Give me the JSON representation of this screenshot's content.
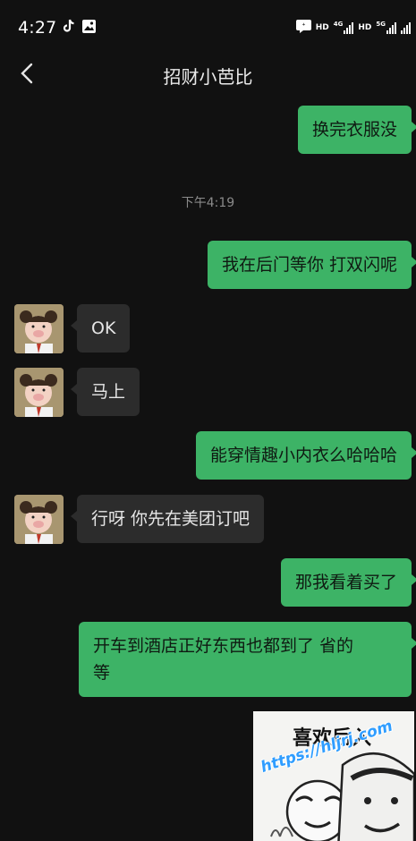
{
  "status_bar": {
    "time": "4:27",
    "left_icons": [
      "tiktok-icon",
      "gallery-icon"
    ],
    "right_icons": [
      "message-badge-icon",
      "hd-label",
      "4g-signal-icon",
      "hd-label",
      "5g-signal-icon",
      "signal-icon"
    ],
    "hd1": "HD",
    "net1": "4G",
    "hd2": "HD",
    "net2": "5G"
  },
  "header": {
    "title": "招财小芭比"
  },
  "messages": [
    {
      "side": "me",
      "text": "换完衣服没"
    },
    {
      "type": "timestamp",
      "text": "下午4:19"
    },
    {
      "side": "me",
      "text": "我在后门等你 打双闪呢"
    },
    {
      "side": "them",
      "text": "OK"
    },
    {
      "side": "them",
      "text": "马上"
    },
    {
      "side": "me",
      "text": "能穿情趣小内衣么哈哈哈"
    },
    {
      "side": "them",
      "text": "行呀 你先在美团订吧"
    },
    {
      "side": "me",
      "text": "那我看着买了"
    },
    {
      "side": "me",
      "line1": "开车到酒店正好东西也都到了 省的",
      "line2": "等"
    }
  ],
  "sticker": {
    "caption": "喜欢后入",
    "watermark_url": "https://hljrj.com"
  },
  "colors": {
    "background": "#111111",
    "bubble_me": "#3db366",
    "bubble_them": "#2c2c2c"
  }
}
